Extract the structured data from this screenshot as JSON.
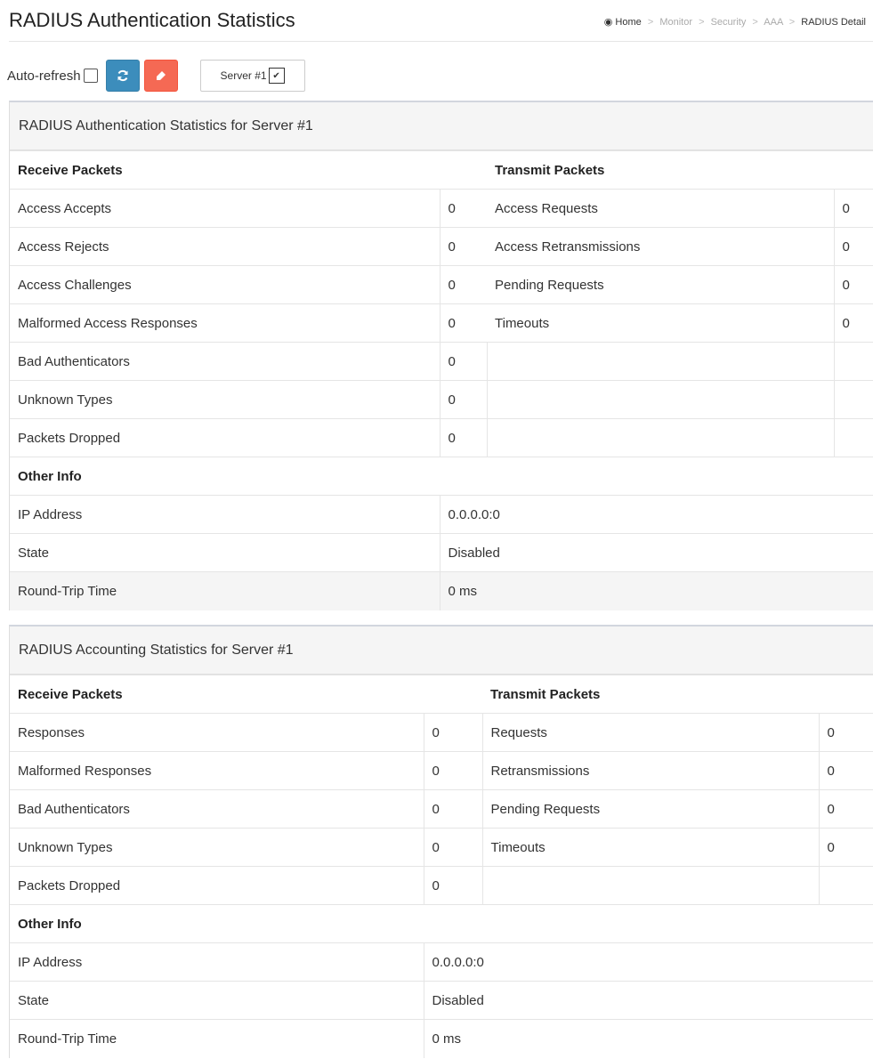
{
  "page_title": "RADIUS Authentication Statistics",
  "breadcrumb": {
    "home": "Home",
    "items": [
      "Monitor",
      "Security",
      "AAA"
    ],
    "current": "RADIUS Detail"
  },
  "controls": {
    "auto_refresh_label": "Auto-refresh",
    "server_selected": "Server #1"
  },
  "auth": {
    "title": "RADIUS Authentication Statistics for Server #1",
    "receive_header": "Receive Packets",
    "transmit_header": "Transmit Packets",
    "rows": [
      {
        "rx_label": "Access Accepts",
        "rx_value": "0",
        "tx_label": "Access Requests",
        "tx_value": "0"
      },
      {
        "rx_label": "Access Rejects",
        "rx_value": "0",
        "tx_label": "Access Retransmissions",
        "tx_value": "0"
      },
      {
        "rx_label": "Access Challenges",
        "rx_value": "0",
        "tx_label": "Pending Requests",
        "tx_value": "0"
      },
      {
        "rx_label": "Malformed Access Responses",
        "rx_value": "0",
        "tx_label": "Timeouts",
        "tx_value": "0"
      },
      {
        "rx_label": "Bad Authenticators",
        "rx_value": "0",
        "tx_label": "",
        "tx_value": ""
      },
      {
        "rx_label": "Unknown Types",
        "rx_value": "0",
        "tx_label": "",
        "tx_value": ""
      },
      {
        "rx_label": "Packets Dropped",
        "rx_value": "0",
        "tx_label": "",
        "tx_value": ""
      }
    ],
    "other_header": "Other Info",
    "other": [
      {
        "label": "IP Address",
        "value": "0.0.0.0:0"
      },
      {
        "label": "State",
        "value": "Disabled"
      },
      {
        "label": "Round-Trip Time",
        "value": "0 ms"
      }
    ]
  },
  "acct": {
    "title": "RADIUS Accounting Statistics for Server #1",
    "receive_header": "Receive Packets",
    "transmit_header": "Transmit Packets",
    "rows": [
      {
        "rx_label": "Responses",
        "rx_value": "0",
        "tx_label": "Requests",
        "tx_value": "0"
      },
      {
        "rx_label": "Malformed Responses",
        "rx_value": "0",
        "tx_label": "Retransmissions",
        "tx_value": "0"
      },
      {
        "rx_label": "Bad Authenticators",
        "rx_value": "0",
        "tx_label": "Pending Requests",
        "tx_value": "0"
      },
      {
        "rx_label": "Unknown Types",
        "rx_value": "0",
        "tx_label": "Timeouts",
        "tx_value": "0"
      },
      {
        "rx_label": "Packets Dropped",
        "rx_value": "0",
        "tx_label": "",
        "tx_value": ""
      }
    ],
    "other_header": "Other Info",
    "other": [
      {
        "label": "IP Address",
        "value": "0.0.0.0:0"
      },
      {
        "label": "State",
        "value": "Disabled"
      },
      {
        "label": "Round-Trip Time",
        "value": "0 ms"
      }
    ]
  },
  "colors": {
    "refresh_button": "#3c8dbc",
    "clear_button": "#f56954",
    "panel_header_bg": "#f5f5f5"
  },
  "icons": {
    "home": "dashboard-icon",
    "refresh": "refresh-icon",
    "clear": "eraser-icon",
    "dropdown": "chevron-down-icon"
  }
}
